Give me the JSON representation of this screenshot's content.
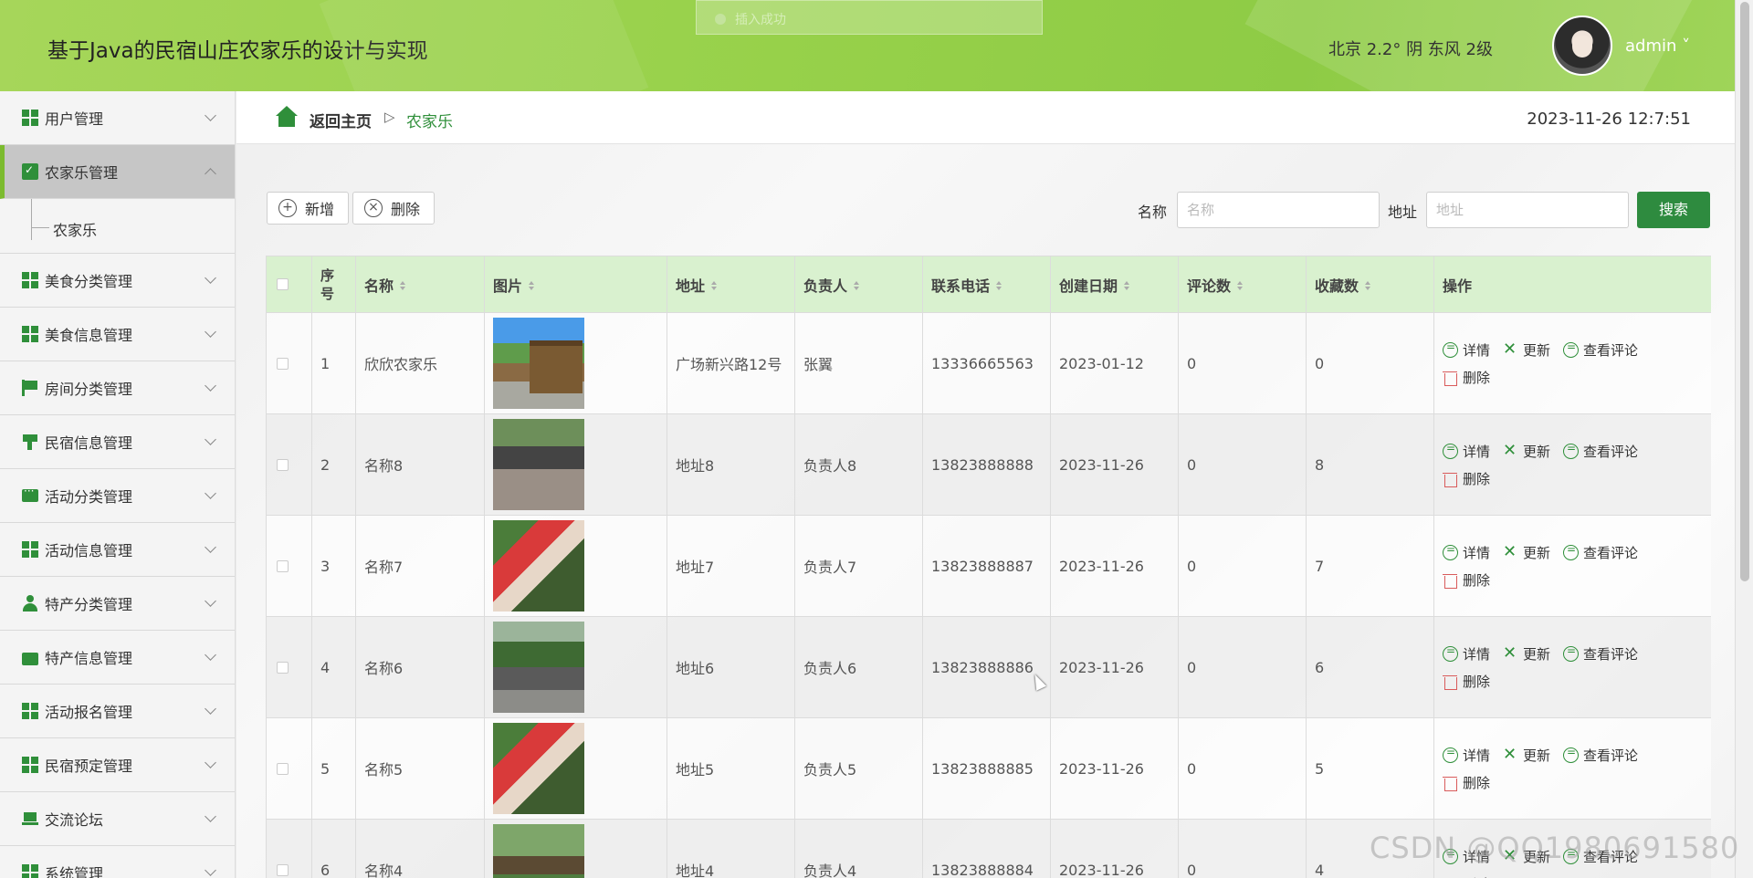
{
  "header": {
    "app_title": "基于Java的民宿山庄农家乐的设计与实现",
    "toast": "插入成功",
    "weather": "北京  2.2°  阴  东风  2级",
    "user": "admin ˅"
  },
  "sidebar": {
    "items": [
      {
        "label": "用户管理",
        "icon": "grid-icon",
        "expanded": false
      },
      {
        "label": "农家乐管理",
        "icon": "clipboard-icon",
        "expanded": true,
        "children": [
          {
            "label": "农家乐"
          }
        ]
      },
      {
        "label": "美食分类管理",
        "icon": "grid-icon",
        "expanded": false
      },
      {
        "label": "美食信息管理",
        "icon": "grid-icon",
        "expanded": false
      },
      {
        "label": "房间分类管理",
        "icon": "flag-icon",
        "expanded": false
      },
      {
        "label": "民宿信息管理",
        "icon": "brush-icon",
        "expanded": false
      },
      {
        "label": "活动分类管理",
        "icon": "chat-icon",
        "expanded": false
      },
      {
        "label": "活动信息管理",
        "icon": "grid-icon",
        "expanded": false
      },
      {
        "label": "特产分类管理",
        "icon": "person-icon",
        "expanded": false
      },
      {
        "label": "特产信息管理",
        "icon": "wallet-icon",
        "expanded": false
      },
      {
        "label": "活动报名管理",
        "icon": "grid-icon",
        "expanded": false
      },
      {
        "label": "民宿预定管理",
        "icon": "grid-icon",
        "expanded": false
      },
      {
        "label": "交流论坛",
        "icon": "laptop-icon",
        "expanded": false
      },
      {
        "label": "系统管理",
        "icon": "grid-icon",
        "expanded": false
      }
    ]
  },
  "breadcrumb": {
    "home": "返回主页",
    "separator": "▷",
    "current": "农家乐"
  },
  "clock": "2023-11-26 12:7:51",
  "toolbar": {
    "add_label": "新增",
    "delete_label": "删除"
  },
  "search": {
    "name_label": "名称",
    "name_placeholder": "名称",
    "address_label": "地址",
    "address_placeholder": "地址",
    "button": "搜索"
  },
  "table": {
    "columns": [
      "序号",
      "名称",
      "图片",
      "地址",
      "负责人",
      "联系电话",
      "创建日期",
      "评论数",
      "收藏数",
      "操作"
    ],
    "actions": {
      "detail": "详情",
      "update": "更新",
      "comments": "查看评论",
      "delete": "删除"
    },
    "rows": [
      {
        "no": "1",
        "name": "欣欣农家乐",
        "address": "广场新兴路12号",
        "manager": "张翼",
        "phone": "13336665563",
        "date": "2023-01-12",
        "comments": "0",
        "favorites": "0"
      },
      {
        "no": "2",
        "name": "名称8",
        "address": "地址8",
        "manager": "负责人8",
        "phone": "13823888888",
        "date": "2023-11-26",
        "comments": "0",
        "favorites": "8"
      },
      {
        "no": "3",
        "name": "名称7",
        "address": "地址7",
        "manager": "负责人7",
        "phone": "13823888887",
        "date": "2023-11-26",
        "comments": "0",
        "favorites": "7"
      },
      {
        "no": "4",
        "name": "名称6",
        "address": "地址6",
        "manager": "负责人6",
        "phone": "13823888886",
        "date": "2023-11-26",
        "comments": "0",
        "favorites": "6"
      },
      {
        "no": "5",
        "name": "名称5",
        "address": "地址5",
        "manager": "负责人5",
        "phone": "13823888885",
        "date": "2023-11-26",
        "comments": "0",
        "favorites": "5"
      },
      {
        "no": "6",
        "name": "名称4",
        "address": "地址4",
        "manager": "负责人4",
        "phone": "13823888884",
        "date": "2023-11-26",
        "comments": "0",
        "favorites": "4"
      }
    ]
  },
  "watermark": "CSDN @QQ1980691580",
  "colors": {
    "accent": "#2e8b3f",
    "header_green": "#97d14a",
    "table_header": "#d9f1cf",
    "delete_red": "#d95b5b"
  }
}
